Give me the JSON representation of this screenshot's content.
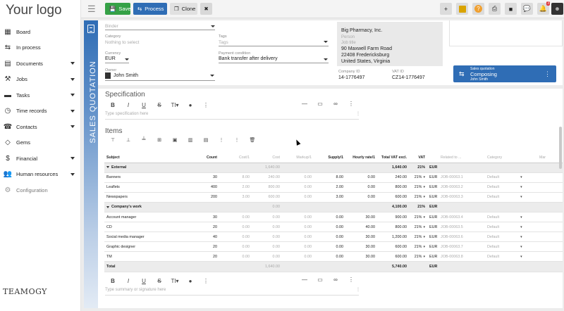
{
  "app": {
    "logo": "Your logo",
    "bottom_logo": "TEAMOGY"
  },
  "sidebar": {
    "items": [
      {
        "label": "Board",
        "icon": "grid-icon",
        "glyph": "▦",
        "caret": false
      },
      {
        "label": "In process",
        "icon": "process-icon",
        "glyph": "⇆",
        "caret": false
      },
      {
        "label": "Documents",
        "icon": "document-icon",
        "glyph": "▤",
        "caret": true
      },
      {
        "label": "Jobs",
        "icon": "hammer-icon",
        "glyph": "⚒",
        "caret": true
      },
      {
        "label": "Tasks",
        "icon": "tasks-icon",
        "glyph": "▬",
        "caret": true
      },
      {
        "label": "Time records",
        "icon": "clock-icon",
        "glyph": "◷",
        "caret": true
      },
      {
        "label": "Contacts",
        "icon": "contacts-icon",
        "glyph": "☎",
        "caret": true
      },
      {
        "label": "Gems",
        "icon": "gem-icon",
        "glyph": "◇",
        "caret": false
      },
      {
        "label": "Financial",
        "icon": "dollar-icon",
        "glyph": "$",
        "caret": true
      },
      {
        "label": "Human resources",
        "icon": "people-icon",
        "glyph": "👥",
        "caret": true
      },
      {
        "label": "Configuration",
        "icon": "gear-icon",
        "glyph": "⚙",
        "caret": false
      }
    ]
  },
  "toolbar": {
    "save": "Save",
    "process": "Process",
    "clone": "Clone",
    "notification_count": "3"
  },
  "document": {
    "vertical_title": "SALES QUOTATION",
    "binder_placeholder": "Binder",
    "category_label": "Category",
    "category_placeholder": "Nothing to select",
    "tags_label": "Tags",
    "tags_placeholder": "Tags",
    "currency_label": "Currency",
    "currency_value": "EUR",
    "payment_label": "Payment condition",
    "payment_value": "Bank transfer after delivery",
    "owner_label": "Owner",
    "owner_value": "John Smith",
    "address": {
      "company": "Big Pharmacy, Inc.",
      "person": "Person",
      "job": "Job title",
      "street": "90 Maxwell Farm Road",
      "city": "22408 Fredericksburg",
      "country": "United States, Virginia"
    },
    "company_id_label": "Company ID",
    "company_id": "14-1776497",
    "vat_id_label": "VAT ID",
    "vat_id": "CZ14-1776497",
    "process_card": {
      "type": "Sales quotation",
      "status": "Composing",
      "user": "John Smith"
    }
  },
  "specification": {
    "title": "Specification",
    "placeholder": "Type specification here"
  },
  "items": {
    "title": "Items",
    "summary_placeholder": "Type summary or signature here",
    "columns": [
      "Subject",
      "Count",
      "Cost/1",
      "Cost",
      "Markup/1",
      "Supply/1",
      "Hourly rate/1",
      "Total VAT excl.",
      "VAT",
      "",
      "Related to ...",
      "Category",
      "Mar"
    ],
    "groups": [
      {
        "name": "External",
        "cost": "1,640.00",
        "total": "1,640.00",
        "vat": "21%",
        "cur": "EUR",
        "rows": [
          {
            "subject": "Banners",
            "count": "30",
            "cost1": "8.00",
            "cost": "240.00",
            "markup": "0.00",
            "supply": "8.00",
            "hourly": "0.00",
            "total": "240.00",
            "vat": "21%",
            "cur": "EUR",
            "related": "JOB-00063.1",
            "category": "Default"
          },
          {
            "subject": "Leaflets",
            "count": "400",
            "cost1": "2.00",
            "cost": "800.00",
            "markup": "0.00",
            "supply": "2.00",
            "hourly": "0.00",
            "total": "800.00",
            "vat": "21%",
            "cur": "EUR",
            "related": "JOB-00063.2",
            "category": "Default"
          },
          {
            "subject": "Newspapers",
            "count": "200",
            "cost1": "3.00",
            "cost": "600.00",
            "markup": "0.00",
            "supply": "3.00",
            "hourly": "0.00",
            "total": "600.00",
            "vat": "21%",
            "cur": "EUR",
            "related": "JOB-00063.3",
            "category": "Default"
          }
        ]
      },
      {
        "name": "Company's work",
        "cost": "0.00",
        "total": "4,100.00",
        "vat": "21%",
        "cur": "EUR",
        "rows": [
          {
            "subject": "Account manager",
            "count": "30",
            "cost1": "0.00",
            "cost": "0.00",
            "markup": "0.00",
            "supply": "0.00",
            "hourly": "30.00",
            "total": "900.00",
            "vat": "21%",
            "cur": "EUR",
            "related": "JOB-00063.4",
            "category": "Default"
          },
          {
            "subject": "CD",
            "count": "20",
            "cost1": "0.00",
            "cost": "0.00",
            "markup": "0.00",
            "supply": "0.00",
            "hourly": "40.00",
            "total": "800.00",
            "vat": "21%",
            "cur": "EUR",
            "related": "JOB-00063.5",
            "category": "Default"
          },
          {
            "subject": "Social media manager",
            "count": "40",
            "cost1": "0.00",
            "cost": "0.00",
            "markup": "0.00",
            "supply": "0.00",
            "hourly": "30.00",
            "total": "1,200.00",
            "vat": "21%",
            "cur": "EUR",
            "related": "JOB-00063.6",
            "category": "Default"
          },
          {
            "subject": "Graphic designer",
            "count": "20",
            "cost1": "0.00",
            "cost": "0.00",
            "markup": "0.00",
            "supply": "0.00",
            "hourly": "30.00",
            "total": "600.00",
            "vat": "21%",
            "cur": "EUR",
            "related": "JOB-00063.7",
            "category": "Default"
          },
          {
            "subject": "TM",
            "count": "20",
            "cost1": "0.00",
            "cost": "0.00",
            "markup": "0.00",
            "supply": "0.00",
            "hourly": "30.00",
            "total": "600.00",
            "vat": "21%",
            "cur": "EUR",
            "related": "JOB-00063.8",
            "category": "Default"
          }
        ]
      }
    ],
    "total": {
      "label": "Total",
      "cost": "1,640.00",
      "total": "5,740.00",
      "cur": "EUR"
    }
  }
}
